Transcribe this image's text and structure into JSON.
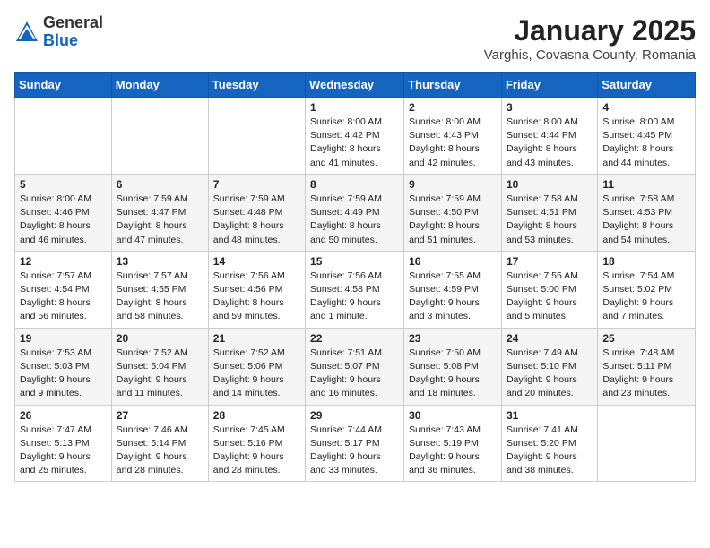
{
  "header": {
    "logo_general": "General",
    "logo_blue": "Blue",
    "month": "January 2025",
    "location": "Varghis, Covasna County, Romania"
  },
  "weekdays": [
    "Sunday",
    "Monday",
    "Tuesday",
    "Wednesday",
    "Thursday",
    "Friday",
    "Saturday"
  ],
  "weeks": [
    [
      {
        "day": "",
        "info": ""
      },
      {
        "day": "",
        "info": ""
      },
      {
        "day": "",
        "info": ""
      },
      {
        "day": "1",
        "info": "Sunrise: 8:00 AM\nSunset: 4:42 PM\nDaylight: 8 hours and 41 minutes."
      },
      {
        "day": "2",
        "info": "Sunrise: 8:00 AM\nSunset: 4:43 PM\nDaylight: 8 hours and 42 minutes."
      },
      {
        "day": "3",
        "info": "Sunrise: 8:00 AM\nSunset: 4:44 PM\nDaylight: 8 hours and 43 minutes."
      },
      {
        "day": "4",
        "info": "Sunrise: 8:00 AM\nSunset: 4:45 PM\nDaylight: 8 hours and 44 minutes."
      }
    ],
    [
      {
        "day": "5",
        "info": "Sunrise: 8:00 AM\nSunset: 4:46 PM\nDaylight: 8 hours and 46 minutes."
      },
      {
        "day": "6",
        "info": "Sunrise: 7:59 AM\nSunset: 4:47 PM\nDaylight: 8 hours and 47 minutes."
      },
      {
        "day": "7",
        "info": "Sunrise: 7:59 AM\nSunset: 4:48 PM\nDaylight: 8 hours and 48 minutes."
      },
      {
        "day": "8",
        "info": "Sunrise: 7:59 AM\nSunset: 4:49 PM\nDaylight: 8 hours and 50 minutes."
      },
      {
        "day": "9",
        "info": "Sunrise: 7:59 AM\nSunset: 4:50 PM\nDaylight: 8 hours and 51 minutes."
      },
      {
        "day": "10",
        "info": "Sunrise: 7:58 AM\nSunset: 4:51 PM\nDaylight: 8 hours and 53 minutes."
      },
      {
        "day": "11",
        "info": "Sunrise: 7:58 AM\nSunset: 4:53 PM\nDaylight: 8 hours and 54 minutes."
      }
    ],
    [
      {
        "day": "12",
        "info": "Sunrise: 7:57 AM\nSunset: 4:54 PM\nDaylight: 8 hours and 56 minutes."
      },
      {
        "day": "13",
        "info": "Sunrise: 7:57 AM\nSunset: 4:55 PM\nDaylight: 8 hours and 58 minutes."
      },
      {
        "day": "14",
        "info": "Sunrise: 7:56 AM\nSunset: 4:56 PM\nDaylight: 8 hours and 59 minutes."
      },
      {
        "day": "15",
        "info": "Sunrise: 7:56 AM\nSunset: 4:58 PM\nDaylight: 9 hours and 1 minute."
      },
      {
        "day": "16",
        "info": "Sunrise: 7:55 AM\nSunset: 4:59 PM\nDaylight: 9 hours and 3 minutes."
      },
      {
        "day": "17",
        "info": "Sunrise: 7:55 AM\nSunset: 5:00 PM\nDaylight: 9 hours and 5 minutes."
      },
      {
        "day": "18",
        "info": "Sunrise: 7:54 AM\nSunset: 5:02 PM\nDaylight: 9 hours and 7 minutes."
      }
    ],
    [
      {
        "day": "19",
        "info": "Sunrise: 7:53 AM\nSunset: 5:03 PM\nDaylight: 9 hours and 9 minutes."
      },
      {
        "day": "20",
        "info": "Sunrise: 7:52 AM\nSunset: 5:04 PM\nDaylight: 9 hours and 11 minutes."
      },
      {
        "day": "21",
        "info": "Sunrise: 7:52 AM\nSunset: 5:06 PM\nDaylight: 9 hours and 14 minutes."
      },
      {
        "day": "22",
        "info": "Sunrise: 7:51 AM\nSunset: 5:07 PM\nDaylight: 9 hours and 16 minutes."
      },
      {
        "day": "23",
        "info": "Sunrise: 7:50 AM\nSunset: 5:08 PM\nDaylight: 9 hours and 18 minutes."
      },
      {
        "day": "24",
        "info": "Sunrise: 7:49 AM\nSunset: 5:10 PM\nDaylight: 9 hours and 20 minutes."
      },
      {
        "day": "25",
        "info": "Sunrise: 7:48 AM\nSunset: 5:11 PM\nDaylight: 9 hours and 23 minutes."
      }
    ],
    [
      {
        "day": "26",
        "info": "Sunrise: 7:47 AM\nSunset: 5:13 PM\nDaylight: 9 hours and 25 minutes."
      },
      {
        "day": "27",
        "info": "Sunrise: 7:46 AM\nSunset: 5:14 PM\nDaylight: 9 hours and 28 minutes."
      },
      {
        "day": "28",
        "info": "Sunrise: 7:45 AM\nSunset: 5:16 PM\nDaylight: 9 hours and 28 minutes."
      },
      {
        "day": "29",
        "info": "Sunrise: 7:44 AM\nSunset: 5:17 PM\nDaylight: 9 hours and 33 minutes."
      },
      {
        "day": "30",
        "info": "Sunrise: 7:43 AM\nSunset: 5:19 PM\nDaylight: 9 hours and 36 minutes."
      },
      {
        "day": "31",
        "info": "Sunrise: 7:41 AM\nSunset: 5:20 PM\nDaylight: 9 hours and 38 minutes."
      },
      {
        "day": "",
        "info": ""
      }
    ]
  ]
}
